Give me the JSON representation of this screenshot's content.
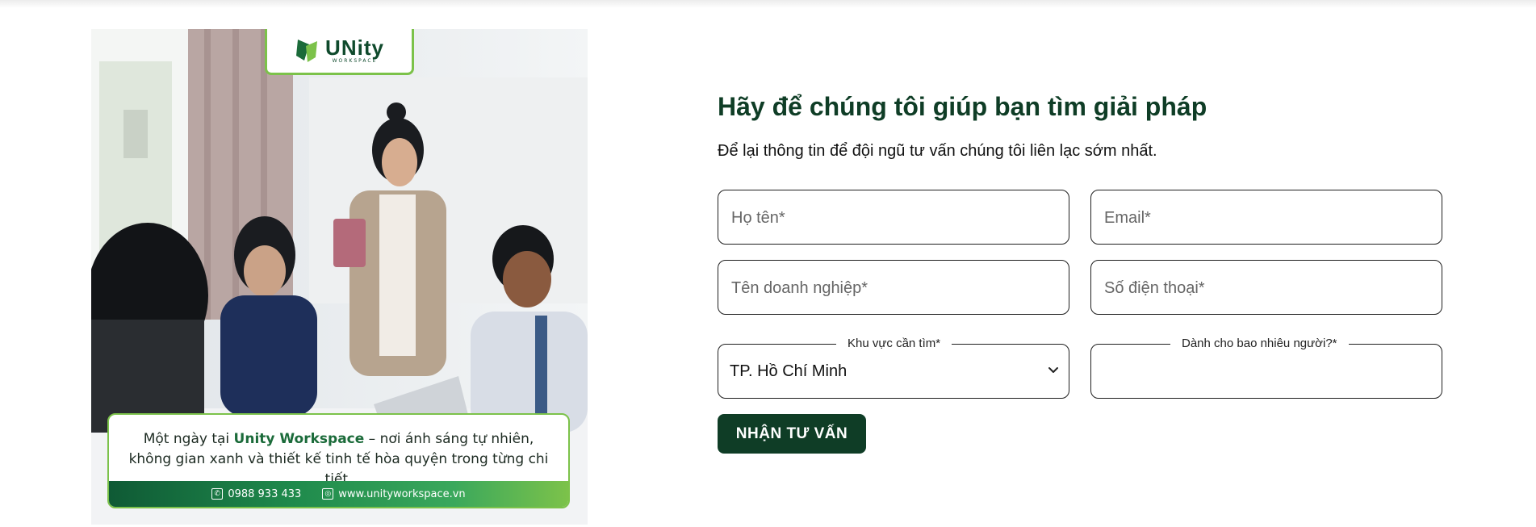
{
  "promo": {
    "logo_text": "UNity",
    "logo_sub": "WORKSPACE",
    "caption_prefix": "Một ngày tại ",
    "caption_brand": "Unity Workspace",
    "caption_suffix": " – nơi ánh sáng tự nhiên, không gian xanh và thiết kế tinh tế hòa quyện trong từng chi tiết.",
    "phone": "0988 933 433",
    "website": "www.unityworkspace.vn",
    "icons": [
      "phone-icon",
      "globe-icon",
      "unity-logo-icon"
    ]
  },
  "form": {
    "title": "Hãy để chúng tôi giúp bạn tìm giải pháp",
    "subtitle": "Để lại thông tin để đội ngũ tư vấn chúng tôi liên lạc sớm nhất.",
    "name_placeholder": "Họ tên*",
    "email_placeholder": "Email*",
    "company_placeholder": "Tên doanh nghiệp*",
    "phone_placeholder": "Số điện thoại*",
    "region_label": "Khu vực cần tìm*",
    "region_value": "TP. Hồ Chí Minh",
    "people_label": "Dành cho bao nhiêu người?*",
    "people_value": "",
    "submit_label": "NHẬN TƯ VẤN"
  },
  "colors": {
    "brand_dark": "#0f3d26",
    "brand_green": "#7cc24a"
  }
}
